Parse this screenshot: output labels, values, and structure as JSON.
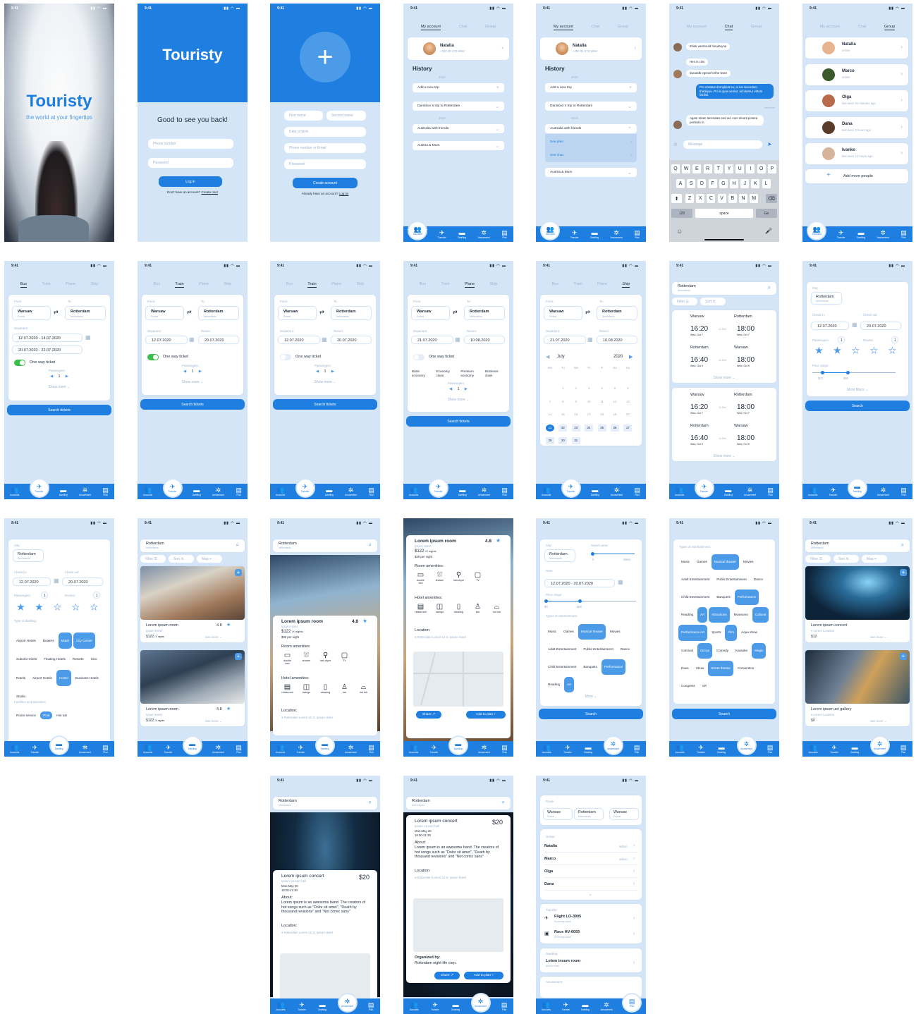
{
  "status_time": "9:41",
  "nav": {
    "accounts": "Accounts",
    "transfer": "Transfer",
    "dwelling": "Dwelling",
    "amusement": "Amusement",
    "plan": "Plan"
  },
  "splash": {
    "title": "Touristy",
    "subtitle": "the world at your fingertips"
  },
  "login": {
    "title": "Touristy",
    "greeting": "Good to see you back!",
    "phone": "Phone number",
    "password": "Password",
    "button": "Log in",
    "footer": "Don't have an account?",
    "footer_link": "Create one!"
  },
  "signup": {
    "first": "First name",
    "second": "Second name",
    "dob": "Date of birth",
    "phone": "Phone number or Email",
    "password": "Password",
    "button": "Create account",
    "footer": "Already have an account?",
    "footer_link": "Log in!"
  },
  "account_tabs": [
    "My account",
    "Chat",
    "Group"
  ],
  "profile": {
    "name": "Natalia",
    "phone": "+380 98 678 9558"
  },
  "history": {
    "title": "History",
    "year1": "2020",
    "year2": "2019",
    "add": "Add a new trip",
    "trip1": "Darinkoo`s trip to Rotterdam",
    "trip2": "Australia with friends",
    "trip3": "Austria & Mum",
    "see_plan": "See plan",
    "see_chat": "See chat"
  },
  "chat": {
    "m1": "Ithink weshould hiredaryna",
    "m2": "Hes in citis",
    "m3": "itwouldb egreat forthe team",
    "m4": "Pro ornatus dornybest ex, ei ius vivendum thankyou. Pri in quas veniat, ad utamur virtute facilisi.",
    "m4_state": "delivered",
    "m5": "Agam etiam tacimates sed ad, eum dicant postea pertindo in.",
    "input": "Message",
    "row1": [
      "Q",
      "W",
      "E",
      "R",
      "T",
      "Y",
      "U",
      "I",
      "O",
      "P"
    ],
    "row2": [
      "A",
      "S",
      "D",
      "F",
      "G",
      "H",
      "J",
      "K",
      "L"
    ],
    "row3": [
      "Z",
      "X",
      "C",
      "V",
      "B",
      "N",
      "M"
    ],
    "num": "123",
    "space": "space",
    "go": "Go"
  },
  "group": {
    "people": [
      {
        "name": "Natalia",
        "status": "online"
      },
      {
        "name": "Marco",
        "status": "online"
      },
      {
        "name": "Olga",
        "status": "last seen 25 minutes ago"
      },
      {
        "name": "Dana",
        "status": "last seen 2 hours ago"
      },
      {
        "name": "Ivanko",
        "status": "last seen 13 hours ago"
      }
    ],
    "add": "Add more people"
  },
  "transport_tabs": [
    "Bus",
    "Train",
    "Plane",
    "Ship"
  ],
  "search": {
    "from": "From:",
    "to": "To:",
    "from_city": "Warsaw",
    "from_country": "Poland",
    "to_city": "Rotterdam",
    "to_country": "Netherlands",
    "departure": "Departure:",
    "return": "Return:",
    "d1": "12.07.2020 - 14.07.2020",
    "d2": "20.07.2020 - 22.07.2020",
    "dep": "12.07.2020",
    "ret": "20.07.2020",
    "plane_dep": "21.07.2020",
    "plane_ret": "10.08.2020",
    "oneway": "One way ticket",
    "passengers": "Passengers:",
    "pcount": "1",
    "show_more": "Show more",
    "button": "Search tickets",
    "classes": [
      "Basic economy",
      "Economy class",
      "Premium economy",
      "Business class"
    ]
  },
  "calendar": {
    "month": "July",
    "year": "2020",
    "days": [
      "Mo",
      "Tu",
      "We",
      "Th",
      "Fr",
      "Sa",
      "Su"
    ]
  },
  "tickets": {
    "city_search": "Rotterdam",
    "city_sub": "Netherlands",
    "filter": "Filter",
    "sort": "Sort",
    "map": "Map",
    "t1": {
      "from": "Warsaw",
      "to": "Rotterdam",
      "dep": "16:20",
      "arr": "18:00",
      "date": "Wed, Oct 7",
      "dur": "1h 20m"
    },
    "t2": {
      "from": "Rotterdam",
      "to": "Warsaw",
      "dep": "16:40",
      "arr": "18:00",
      "date": "Wed, Oct 9",
      "dur": "1h 20m"
    },
    "show_more": "Show more"
  },
  "dwelling": {
    "city_label": "City:",
    "city": "Rotterdam",
    "check_in": "Check in:",
    "check_out": "Check out:",
    "in": "12.07.2020",
    "out": "20.07.2020",
    "passengers": "Passengers:",
    "rooms": "Rooms:",
    "pc": "1",
    "rc": "1",
    "price": "Price range:",
    "pmin": "$23",
    "pmax": "$90",
    "more": "More filters",
    "search": "Search",
    "type": "Type of dwelling:",
    "types": [
      "Airport Hotels",
      "Boaters",
      "Motel",
      "City Center",
      "Suburb Hotels",
      "Floating Hotels",
      "Resorts",
      "Sico",
      "Rotels",
      "Airport Hotels",
      "Hostel",
      "Business Hotels",
      "Studio"
    ],
    "facilities": "Facilities and amenities:",
    "fac": [
      "Room service",
      "Pool",
      "Hot tub"
    ]
  },
  "rooms": {
    "name": "Lorem ipsum room",
    "hotel": "Ipsum Hotel",
    "rating": "4.8",
    "price": "$122",
    "per": "/X nights",
    "night": "$30 per night",
    "see_more": "See more",
    "amenities": "Room amenities:",
    "hotel_am": "Hotel amenities:",
    "location": "Location:",
    "loc_text": "Rotterdam Lorem 12 st. Ipsum Hotel",
    "share": "Share",
    "add": "Add to plan",
    "room_items": [
      "double bed",
      "shower",
      "hair dryer",
      "TV"
    ],
    "hotel_items": [
      "restaurant",
      "swings",
      "cleaning",
      "bar",
      "hot tub"
    ]
  },
  "amusement": {
    "city": "Rotterdam",
    "search_area": "Search area:",
    "area_min": "0",
    "area_max": "68km",
    "date_label": "Date:",
    "date": "12.07.2020 - 20.07.2020",
    "price": "Price range:",
    "pmin": "$0",
    "pmax": "$90",
    "types_label": "Types of entertainment:",
    "chips": [
      "Music",
      "Games",
      "Musical theater",
      "Movies",
      "Adult Entertainment",
      "Public Entertainment",
      "Dance",
      "Child Entertainment",
      "Banquets",
      "Performance",
      "Reading",
      "Art"
    ],
    "more": "More",
    "search": "Search",
    "extra": [
      "Attractions",
      "Museums",
      "Cultural",
      "Performance Art",
      "Sports",
      "Film",
      "Aqua show",
      "Carnival",
      "Circus",
      "Comedy",
      "Karaoke",
      "Magic",
      "Rave",
      "Show",
      "Street theater",
      "Convention",
      "Congress",
      "VR"
    ]
  },
  "events": {
    "concert": "Lorem ipsum concert",
    "hall": "Ipsum concert hall",
    "loc": "Lorem Location",
    "price": "$12",
    "gallery": "Lorem ipsum art gallery",
    "gprice": "$0",
    "see_more": "See more",
    "detail_price": "$20",
    "date": "Mon,May 20",
    "time": "19:00-21:30",
    "about": "About:",
    "about_text": "Lorem ipsum is an awesome band. The creators of hot songs such as \"Dolor sit amet\", \"Death by thousand revisions\" and \"Not comic sans\"",
    "location": "Location:",
    "loc_text": "Rotterdam Lorem 12 st. Ipsum Hotel",
    "organized": "Organized by:",
    "org_text": "Rotterdam night-life corp."
  },
  "plan": {
    "route": "Route",
    "r1": "Warsaw",
    "r1c": "Poland",
    "r2": "Rotterdam",
    "r2c": "Netherlands",
    "r3": "Warsaw",
    "r3c": "Poland",
    "group": "Group:",
    "members": [
      {
        "n": "Natalia",
        "r": "admin"
      },
      {
        "n": "Marco",
        "r": "admin"
      },
      {
        "n": "Olga",
        "r": ""
      },
      {
        "n": "Dana",
        "r": ""
      }
    ],
    "transfer": "Transfer:",
    "f1": "Flight LO-3905",
    "f1c": "Economy class",
    "f2": "Race HV-6093",
    "f2c": "Economy class",
    "dwelling": "Dwelling:",
    "room": "Lolem insum room",
    "hotel": "Ipsum Hotel",
    "amusement": "Amusement:"
  },
  "colors": {
    "primary": "#1e7fe0",
    "bg": "#d4e5f8",
    "chip": "#4c9be8"
  }
}
